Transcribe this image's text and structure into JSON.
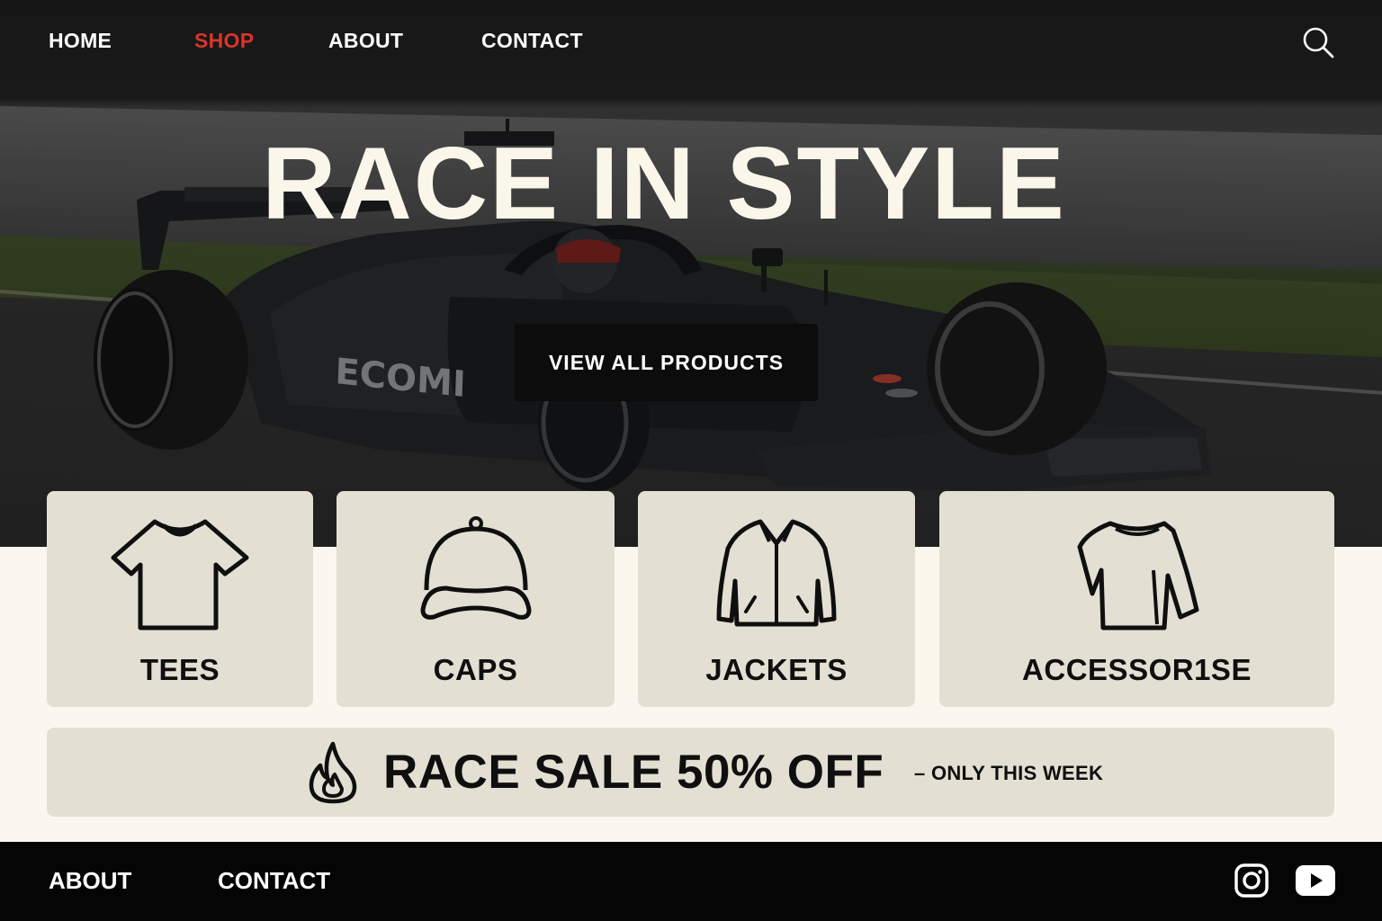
{
  "nav": {
    "items": [
      {
        "label": "HOME"
      },
      {
        "label": "SHOP",
        "active": true
      },
      {
        "label": "ABOUT"
      },
      {
        "label": "CONTACT"
      }
    ],
    "active_color": "#d9352b"
  },
  "hero": {
    "title": "RACE IN STYLE",
    "car_livery_text": "ECOMI",
    "cta_label": "VIEW ALL PRODUCTS"
  },
  "categories": [
    {
      "label": "TEES",
      "icon": "tshirt-icon"
    },
    {
      "label": "CAPS",
      "icon": "cap-icon"
    },
    {
      "label": "JACKETS",
      "icon": "jacket-icon"
    },
    {
      "label": "ACCESSOR1SE",
      "icon": "scarf-icon"
    }
  ],
  "promo": {
    "icon": "fire-icon",
    "headline": "RACE SALE 50% OFF",
    "subtext": "– ONLY THIS WEEK"
  },
  "footer": {
    "links": [
      {
        "label": "ABOUT"
      },
      {
        "label": "CONTACT"
      }
    ],
    "social": [
      "instagram-icon",
      "youtube-icon"
    ]
  },
  "colors": {
    "background": "#fbf7ee",
    "card": "#e3dfd3",
    "footer": "#050505",
    "text_dark": "#0f0f0f"
  }
}
